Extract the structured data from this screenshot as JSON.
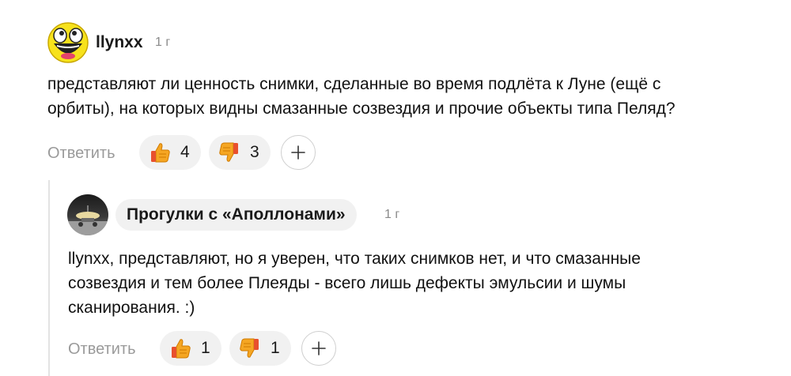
{
  "comment": {
    "author": "llynxx",
    "time": "1 г",
    "text_line1": "представляют ли ценность снимки, сделанные во время подлёта к Луне (ещё с",
    "text_line2": "орбиты), на которых видны смазанные созвездия и прочие объекты типа Пеляд?",
    "reply_label": "Ответить",
    "likes": "4",
    "dislikes": "3"
  },
  "reply": {
    "author": "Прогулки с «Аполлонами»",
    "time": "1 г",
    "text_line1": "llynxx, представляют, но я уверен, что таких снимков нет, и что смазанные",
    "text_line2": "созвездия и тем более Плеяды - всего лишь дефекты эмульсии и шумы",
    "text_line3": "сканирования. :)",
    "reply_label": "Ответить",
    "likes": "1",
    "dislikes": "1"
  },
  "icons": {
    "like": "thumbs-up-icon",
    "dislike": "thumbs-down-icon",
    "add": "plus-icon"
  },
  "colors": {
    "pill_bg": "#f1f1f1",
    "muted_text": "#9a9a9a",
    "emoji_orange": "#f5a623"
  }
}
